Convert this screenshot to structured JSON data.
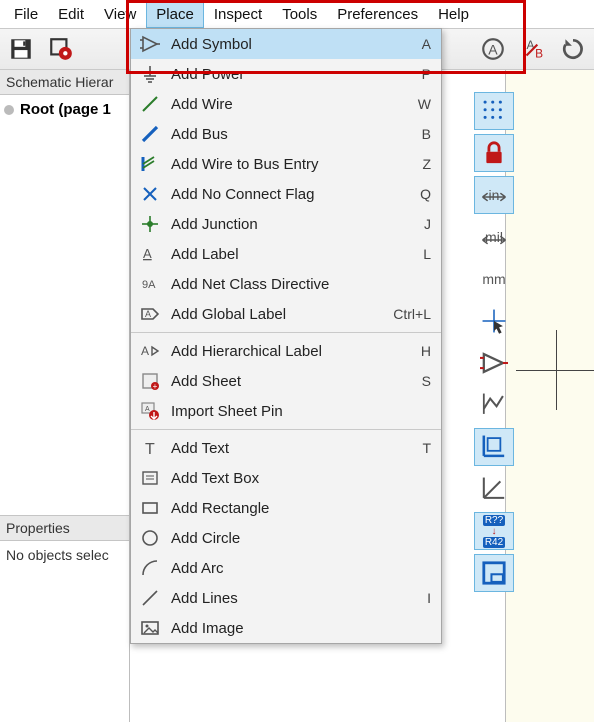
{
  "menubar": {
    "items": [
      "File",
      "Edit",
      "View",
      "Place",
      "Inspect",
      "Tools",
      "Preferences",
      "Help"
    ],
    "active_index": 3
  },
  "sidebar": {
    "hierarchy_title": "Schematic Hierar",
    "root_label": "Root (page 1",
    "properties_title": "Properties",
    "properties_text": "No objects selec"
  },
  "dropdown": {
    "groups": [
      [
        {
          "icon": "opamp",
          "label": "Add Symbol",
          "shortcut": "A",
          "hover": true
        },
        {
          "icon": "power",
          "label": "Add Power",
          "shortcut": "P"
        },
        {
          "icon": "wire",
          "label": "Add Wire",
          "shortcut": "W"
        },
        {
          "icon": "bus",
          "label": "Add Bus",
          "shortcut": "B"
        },
        {
          "icon": "busentry",
          "label": "Add Wire to Bus Entry",
          "shortcut": "Z"
        },
        {
          "icon": "noconnect",
          "label": "Add No Connect Flag",
          "shortcut": "Q"
        },
        {
          "icon": "junction",
          "label": "Add Junction",
          "shortcut": "J"
        },
        {
          "icon": "label",
          "label": "Add Label",
          "shortcut": "L"
        },
        {
          "icon": "netclass",
          "label": "Add Net Class Directive",
          "shortcut": ""
        },
        {
          "icon": "globallabel",
          "label": "Add Global Label",
          "shortcut": "Ctrl+L"
        }
      ],
      [
        {
          "icon": "hierlabel",
          "label": "Add Hierarchical Label",
          "shortcut": "H"
        },
        {
          "icon": "sheet",
          "label": "Add Sheet",
          "shortcut": "S"
        },
        {
          "icon": "importpin",
          "label": "Import Sheet Pin",
          "shortcut": ""
        }
      ],
      [
        {
          "icon": "text",
          "label": "Add Text",
          "shortcut": "T"
        },
        {
          "icon": "textbox",
          "label": "Add Text Box",
          "shortcut": ""
        },
        {
          "icon": "rect",
          "label": "Add Rectangle",
          "shortcut": ""
        },
        {
          "icon": "circle",
          "label": "Add Circle",
          "shortcut": ""
        },
        {
          "icon": "arc",
          "label": "Add Arc",
          "shortcut": ""
        },
        {
          "icon": "lines",
          "label": "Add Lines",
          "shortcut": "I"
        },
        {
          "icon": "image",
          "label": "Add Image",
          "shortcut": ""
        }
      ]
    ]
  },
  "right_toolbar": {
    "items": [
      {
        "name": "grid-icon",
        "label": "",
        "sel": true,
        "kind": "grid"
      },
      {
        "name": "lock-icon",
        "label": "",
        "sel": true,
        "kind": "lock"
      },
      {
        "name": "units-in",
        "label": "in",
        "sel": true,
        "kind": "text",
        "arrow": true
      },
      {
        "name": "units-mil",
        "label": "mil",
        "sel": false,
        "kind": "text",
        "arrow": true
      },
      {
        "name": "units-mm",
        "label": "mm",
        "sel": false,
        "kind": "text"
      },
      {
        "name": "cursor-icon",
        "label": "",
        "sel": false,
        "kind": "cursor"
      },
      {
        "name": "opamp-icon",
        "label": "",
        "sel": false,
        "kind": "opamp"
      },
      {
        "name": "plot-icon",
        "label": "",
        "sel": false,
        "kind": "plot"
      },
      {
        "name": "axes-icon",
        "label": "",
        "sel": true,
        "kind": "axes"
      },
      {
        "name": "axes2-icon",
        "label": "",
        "sel": false,
        "kind": "axes2"
      },
      {
        "name": "ref-icon",
        "label": "",
        "sel": true,
        "kind": "ref"
      },
      {
        "name": "sheet-icon",
        "label": "",
        "sel": true,
        "kind": "sheetframe"
      }
    ],
    "ref_top": "R??",
    "ref_bot": "R42"
  },
  "colors": {
    "highlight": "#bfe0f5",
    "accent_red": "#c01818"
  }
}
